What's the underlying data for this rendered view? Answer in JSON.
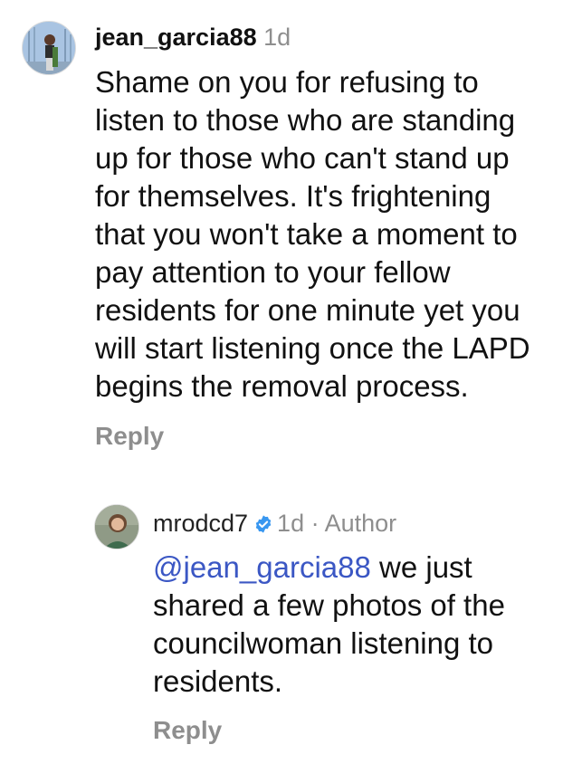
{
  "comments": [
    {
      "username": "jean_garcia88",
      "time": "1d",
      "text_lines": [
        "Shame on you for refusing to",
        "listen to those who are standing",
        "up for those who can't stand up",
        "for themselves. It's frightening",
        "that you won't take a moment to",
        "pay attention to your fellow",
        "residents for one minute yet you",
        "will start listening once the LAPD",
        "begins the removal process."
      ],
      "reply_label": "Reply"
    },
    {
      "username": "mrodcd7",
      "verified": true,
      "time": "1d",
      "separator": "·",
      "author_label": "Author",
      "mention": "@jean_garcia88",
      "text_first_line_rest": " we just",
      "text_lines": [
        "shared a few photos of the",
        "councilwoman listening to",
        "residents."
      ],
      "reply_label": "Reply"
    }
  ],
  "colors": {
    "meta_gray": "#8e8e8e",
    "mention_blue": "#3b57c4",
    "verified_blue": "#3897f0"
  },
  "icons": {
    "verified": "verified-badge-icon"
  }
}
